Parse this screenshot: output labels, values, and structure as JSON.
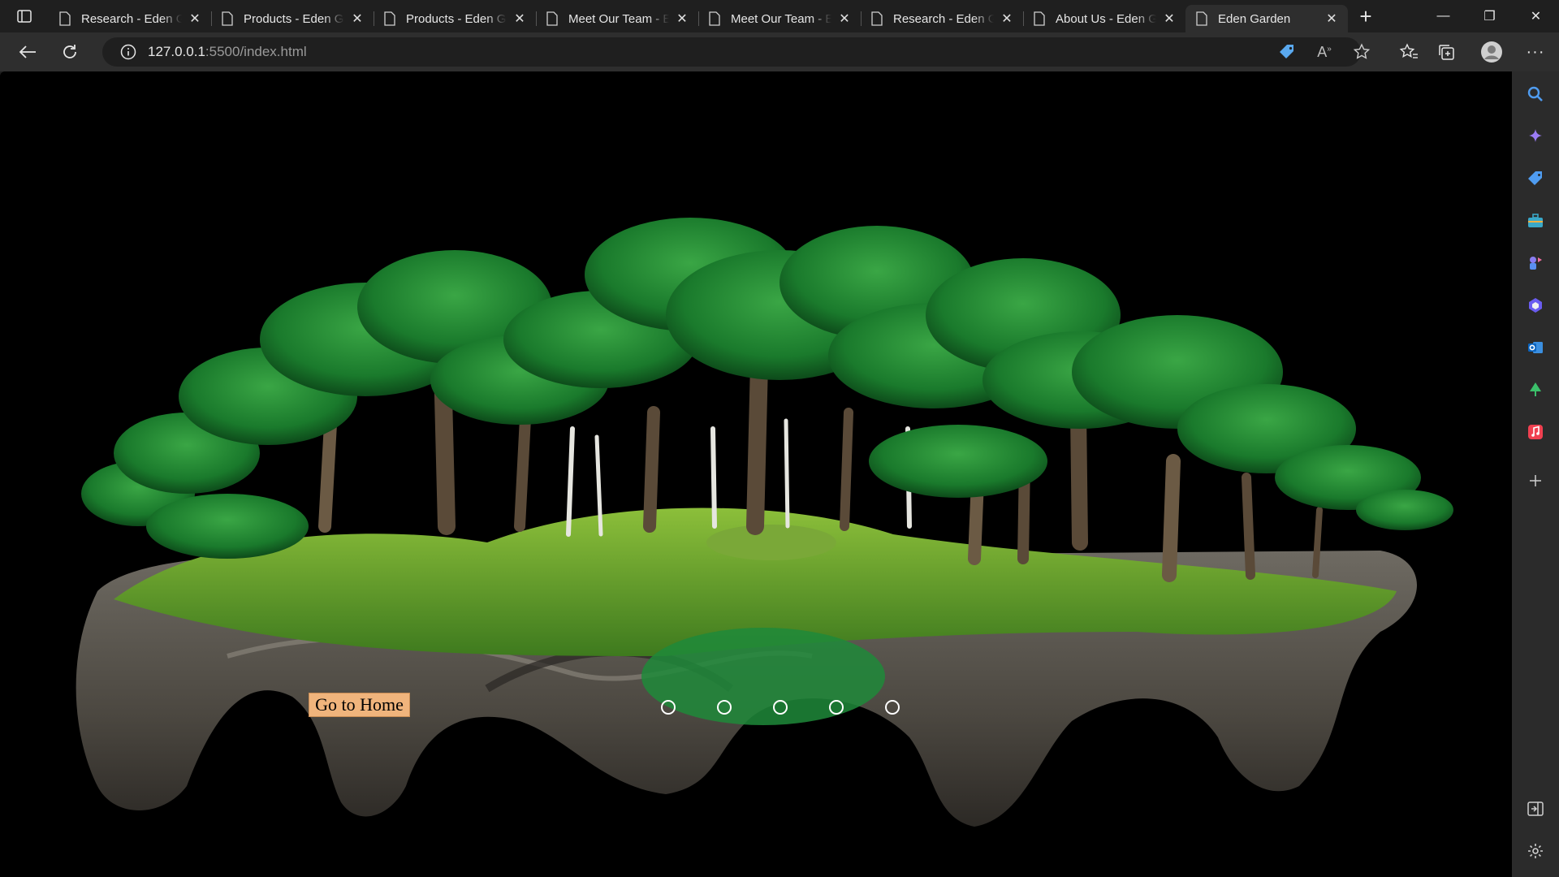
{
  "browser": {
    "tabs": [
      {
        "title": "Research - Eden Garden",
        "active": false
      },
      {
        "title": "Products - Eden Garden",
        "active": false
      },
      {
        "title": "Products - Eden Garden",
        "active": false
      },
      {
        "title": "Meet Our Team - Eden Garden",
        "active": false
      },
      {
        "title": "Meet Our Team - Eden Garden",
        "active": false
      },
      {
        "title": "Research - Eden Garden",
        "active": false
      },
      {
        "title": "About Us - Eden Garden",
        "active": false
      },
      {
        "title": "Eden Garden",
        "active": true
      }
    ],
    "address": {
      "host": "127.0.0.1",
      "rest": ":5500/index.html"
    }
  },
  "page": {
    "hero_image": "bonsai-forest-on-driftwood",
    "go_home_label": "Go to Home",
    "slide_count": 5
  },
  "colors": {
    "button_bg": "#f0b47c",
    "page_bg": "#000000",
    "dot_border": "#ffffff"
  }
}
